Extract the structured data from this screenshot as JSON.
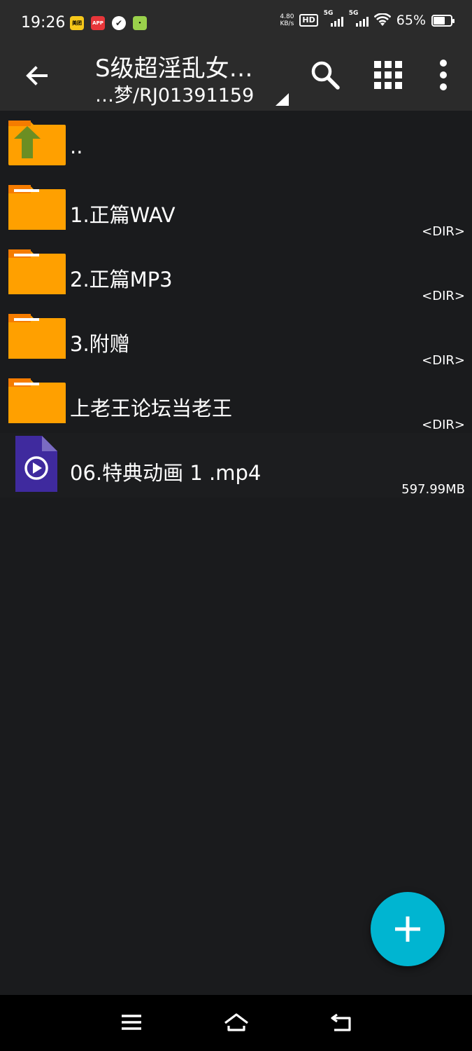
{
  "status_bar": {
    "time": "19:26",
    "notifications": [
      {
        "icon": "meituan-icon",
        "text": "美团"
      },
      {
        "icon": "app-red-icon",
        "text": "APP"
      },
      {
        "icon": "check-icon",
        "text": "✔"
      },
      {
        "icon": "app-green-icon",
        "text": "•"
      }
    ],
    "net_speed_value": "4.80",
    "net_speed_unit": "KB/s",
    "hd_label": "HD",
    "signal_1_label": "5G",
    "signal_2_label": "5G",
    "battery_percent": "65%",
    "battery_level": 0.65
  },
  "app_bar": {
    "title": "S级超淫乱女…",
    "subtitle": "…梦/RJ01391159",
    "icons": [
      "back-arrow-icon",
      "search-icon",
      "grid-view-icon",
      "more-vert-icon"
    ]
  },
  "files": [
    {
      "name": "..",
      "meta": "",
      "icon": "folder-up-icon"
    },
    {
      "name": "1.正篇WAV",
      "meta": "<DIR>",
      "icon": "folder-icon"
    },
    {
      "name": "2.正篇MP3",
      "meta": "<DIR>",
      "icon": "folder-icon"
    },
    {
      "name": "3.附赠",
      "meta": "<DIR>",
      "icon": "folder-icon"
    },
    {
      "name": "上老王论坛当老王",
      "meta": "<DIR>",
      "icon": "folder-icon"
    },
    {
      "name": "06.特典动画 1 .mp4",
      "meta": "597.99MB",
      "icon": "video-file-icon"
    }
  ],
  "fab": {
    "icon": "plus-icon"
  },
  "nav_bar": {
    "icons": [
      "menu-icon",
      "home-icon",
      "back-icon"
    ]
  },
  "colors": {
    "background": "#1a1b1d",
    "bar": "#2b2b2b",
    "folder": "#ffa000",
    "folder_tab": "#f57c00",
    "up_arrow": "#6b8e23",
    "video_file": "#3f2a9e",
    "fab": "#00b5d1"
  }
}
